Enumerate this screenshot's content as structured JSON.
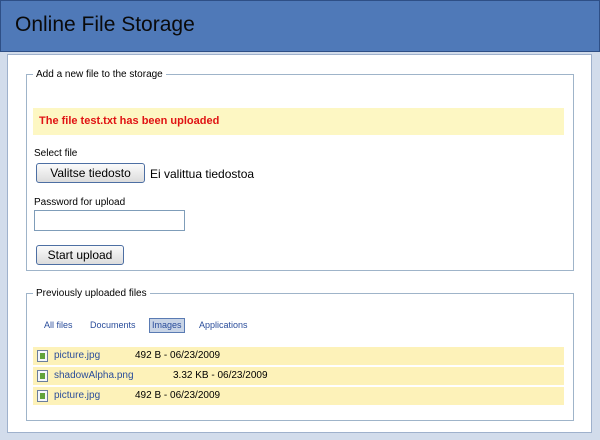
{
  "header": {
    "title": "Online File Storage"
  },
  "upload": {
    "legend": "Add a new file to the storage",
    "notice": "The file test.txt has been uploaded",
    "select_label": "Select file",
    "choose_button": "Valitse tiedosto",
    "no_file_text": "Ei valittua tiedostoa",
    "password_label": "Password for upload",
    "password_value": "",
    "start_button": "Start upload"
  },
  "files": {
    "legend": "Previously uploaded files",
    "filters": [
      {
        "label": "All files",
        "active": false
      },
      {
        "label": "Documents",
        "active": false
      },
      {
        "label": "Images",
        "active": true
      },
      {
        "label": "Applications",
        "active": false
      }
    ],
    "rows": [
      {
        "name": "picture.jpg",
        "meta": "492 B - 06/23/2009",
        "icon": "image-file-icon"
      },
      {
        "name": "shadowAlpha.png",
        "meta": "3.32 KB - 06/23/2009",
        "icon": "image-file-icon"
      },
      {
        "name": "picture.jpg",
        "meta": "492 B - 06/23/2009",
        "icon": "image-file-icon"
      }
    ]
  }
}
